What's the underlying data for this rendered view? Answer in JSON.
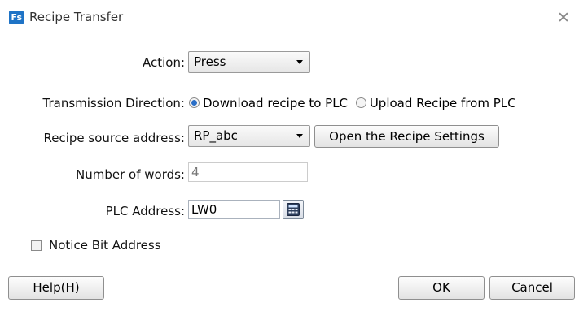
{
  "window": {
    "title": "Recipe Transfer",
    "app_icon_text": "Fs",
    "close_glyph": "✕"
  },
  "form": {
    "action": {
      "label": "Action:",
      "value": "Press"
    },
    "direction": {
      "label": "Transmission Direction:",
      "options": [
        {
          "label": "Download recipe to PLC",
          "checked": true
        },
        {
          "label": "Upload Recipe from PLC",
          "checked": false
        }
      ]
    },
    "source": {
      "label": "Recipe source address:",
      "value": "RP_abc",
      "settings_button": "Open the Recipe Settings"
    },
    "words": {
      "label": "Number of words:",
      "value": "4"
    },
    "plc": {
      "label": "PLC Address:",
      "value": "LW0",
      "picker_icon": "keypad-icon"
    },
    "notice": {
      "label": "Notice Bit Address",
      "checked": false
    }
  },
  "footer": {
    "help": "Help(H)",
    "ok": "OK",
    "cancel": "Cancel"
  },
  "colors": {
    "app_icon": "#1e73c6",
    "radio_selected": "#2b6fc7"
  }
}
